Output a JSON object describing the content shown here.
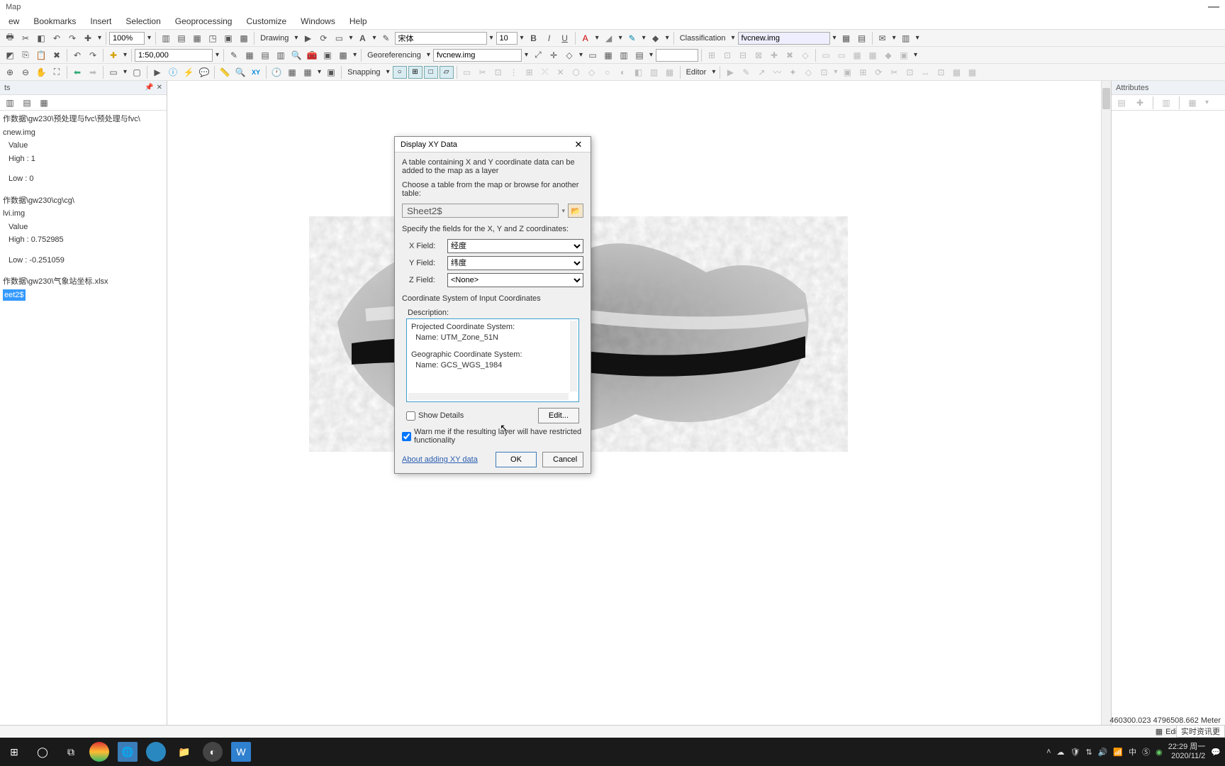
{
  "app": {
    "title": "Map"
  },
  "menu": {
    "items": [
      "ew",
      "Bookmarks",
      "Insert",
      "Selection",
      "Geoprocessing",
      "Customize",
      "Windows",
      "Help"
    ]
  },
  "toolbar1": {
    "zoom_pct": "100%",
    "drawing_label": "Drawing",
    "font_name": "宋体",
    "font_size": "10",
    "classification_label": "Classification",
    "class_layer": "fvcnew.img"
  },
  "toolbar2": {
    "scale": "1:50,000",
    "georef_label": "Georeferencing",
    "georef_layer": "fvcnew.img"
  },
  "toolbar3": {
    "snapping_label": "Snapping",
    "editor_label": "Editor"
  },
  "contents": {
    "title": "ts",
    "path1": "作数据\\gw230\\预处理与fvc\\预处理与fvc\\",
    "layer1": "cnew.img",
    "value_label": "Value",
    "l1_high": "High : 1",
    "l1_low": "Low : 0",
    "path2": "作数据\\gw230\\cg\\cg\\",
    "layer2": "lvi.img",
    "l2_high": "High : 0.752985",
    "l2_low": "Low : -0.251059",
    "path3": "作数据\\gw230\\气象站坐标.xlsx",
    "sheet": "eet2$"
  },
  "attributes": {
    "title": "Attributes"
  },
  "dialog": {
    "title": "Display XY Data",
    "intro": "A table containing X and Y coordinate data can be added to the map as a layer",
    "choose_label": "Choose a table from the map or browse for another table:",
    "table_value": "Sheet2$",
    "specify_label": "Specify the fields for the X, Y and Z coordinates:",
    "x_label": "X Field:",
    "x_value": "经度",
    "y_label": "Y Field:",
    "y_value": "纬度",
    "z_label": "Z Field:",
    "z_value": "<None>",
    "coord_header": "Coordinate System of Input Coordinates",
    "desc_label": "Description:",
    "desc_line1": "Projected Coordinate System:",
    "desc_line2": "  Name: UTM_Zone_51N",
    "desc_line3": "Geographic Coordinate System:",
    "desc_line4": "  Name: GCS_WGS_1984",
    "show_details": "Show Details",
    "edit_btn": "Edit...",
    "warn_label": "Warn me if the resulting layer will have restricted functionality",
    "about_link": "About adding XY data",
    "ok": "OK",
    "cancel": "Cancel"
  },
  "status": {
    "edit_sketch": "Edit Sketch Pro",
    "coords": "460300.023  4796508.662 Meter",
    "news": "实时资讯更"
  },
  "taskbar": {
    "time": "22:29 周一",
    "date": "2020/11/2",
    "ime": "中"
  }
}
